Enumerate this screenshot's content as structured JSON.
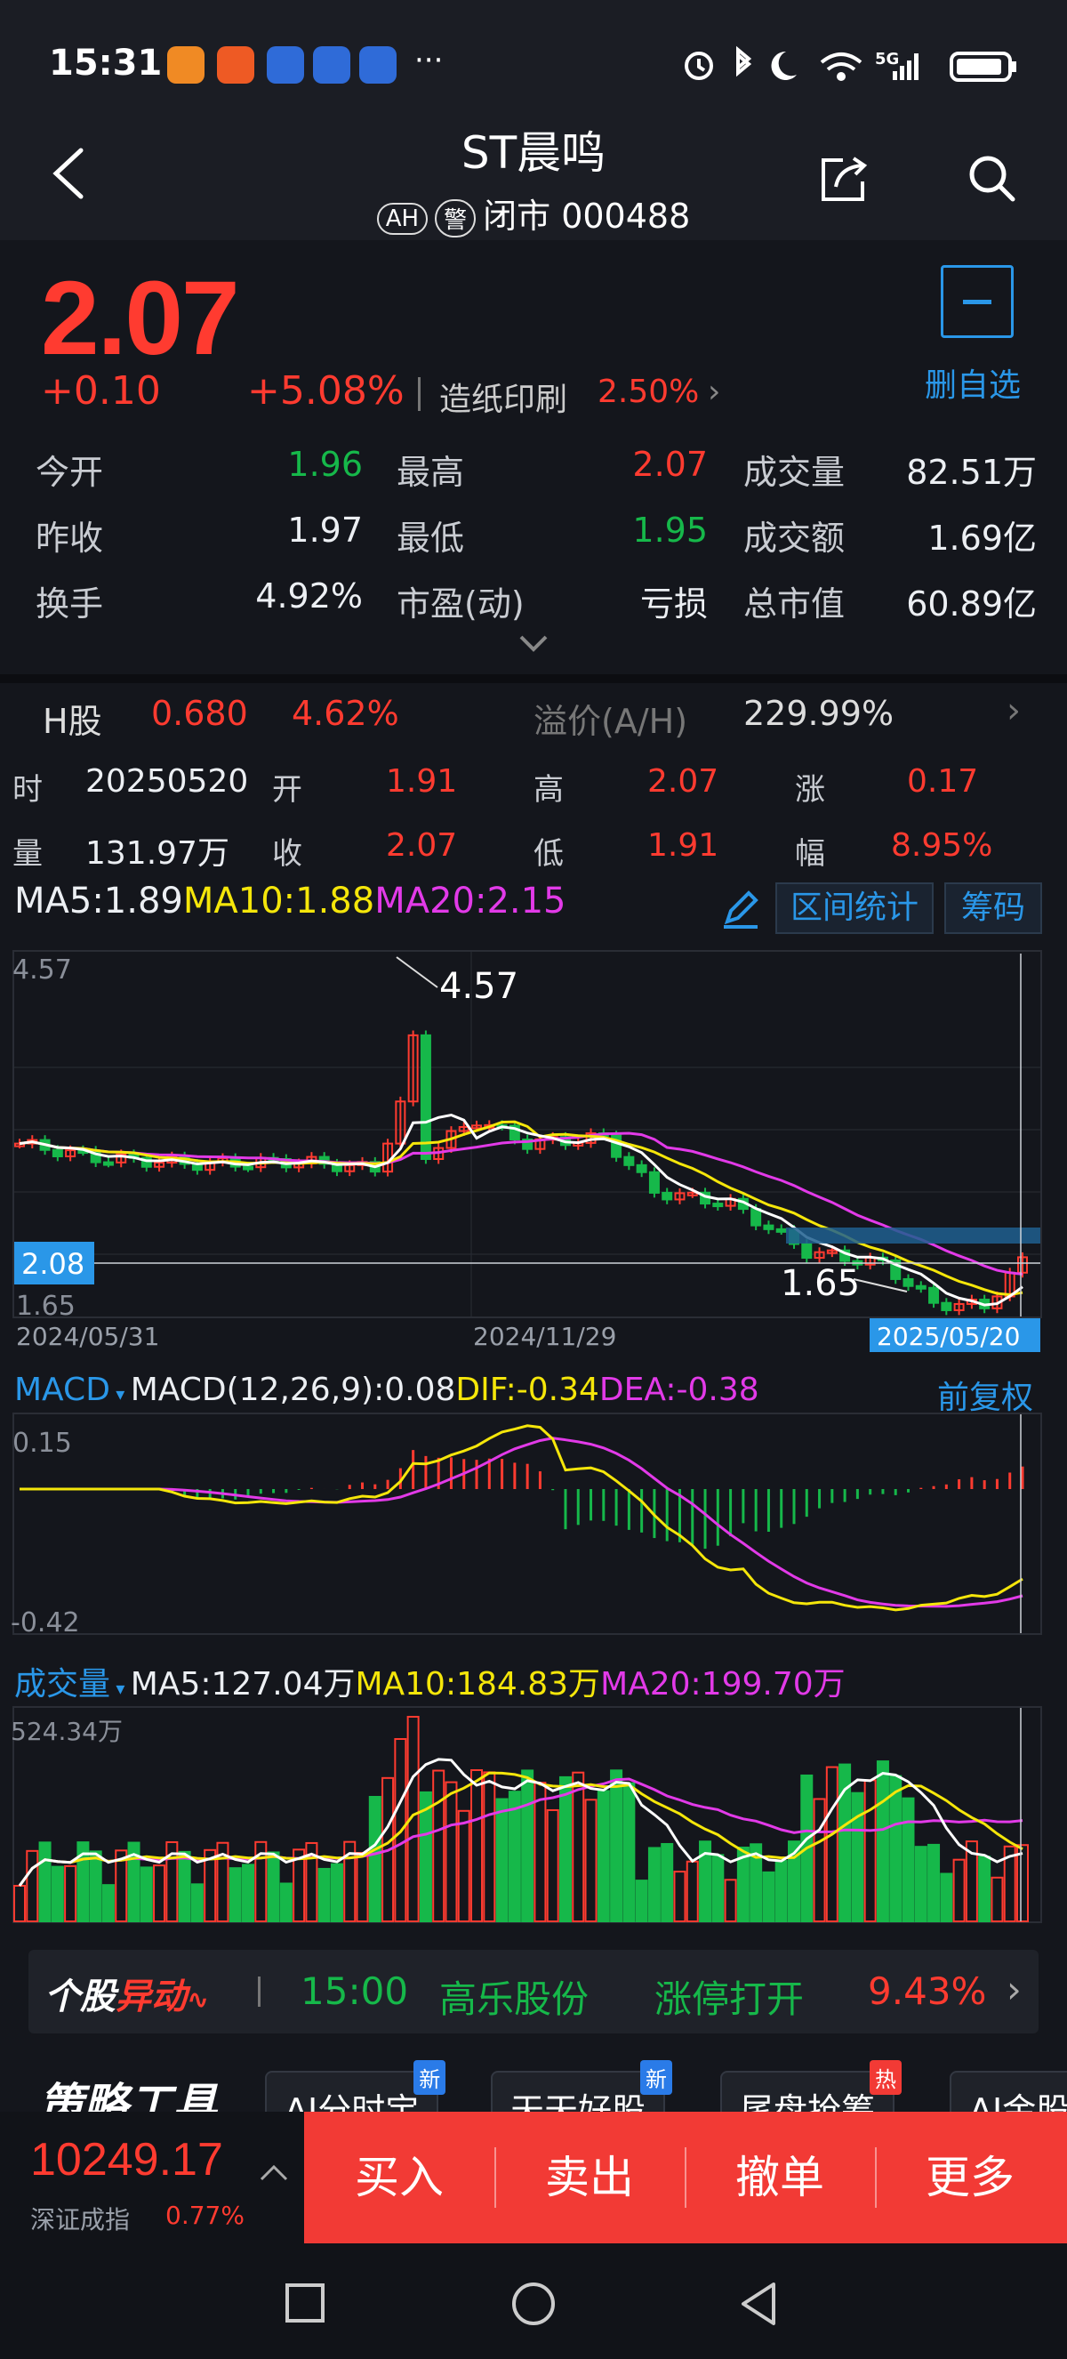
{
  "status_bar": {
    "time": "15:31",
    "dots": "···",
    "network": "5G"
  },
  "header": {
    "title": "ST晨鸣",
    "badge_ah": "AH",
    "badge_warn": "警",
    "subtitle": "闭市 000488"
  },
  "quote": {
    "price": "2.07",
    "change": "+0.10",
    "change_pct": "+5.08%",
    "sector": "造纸印刷",
    "sector_pct": "2.50%",
    "watch_label": "删自选",
    "open_label": "今开",
    "open": "1.96",
    "high_label": "最高",
    "high": "2.07",
    "volume_label": "成交量",
    "volume": "82.51万",
    "prev_close_label": "昨收",
    "prev_close": "1.97",
    "low_label": "最低",
    "low": "1.95",
    "amount_label": "成交额",
    "amount": "1.69亿",
    "turnover_label": "换手",
    "turnover": "4.92%",
    "pe_label": "市盈(动)",
    "pe": "亏损",
    "mktcap_label": "总市值",
    "mktcap": "60.89亿"
  },
  "h_share": {
    "label": "H股",
    "price": "0.680",
    "pct": "4.62%",
    "premium_label": "溢价(A/H)",
    "premium": "229.99%"
  },
  "day_info": {
    "date_label": "时",
    "date": "20250520",
    "open_label": "开",
    "open": "1.91",
    "high_label": "高",
    "high": "2.07",
    "rise_label": "涨",
    "rise": "0.17",
    "vol_label": "量",
    "vol": "131.97万",
    "close_label": "收",
    "close": "2.07",
    "low_label": "低",
    "low": "1.91",
    "amp_label": "幅",
    "amp": "8.95%"
  },
  "ma": {
    "ma5": "MA5:1.89",
    "ma10": "MA10:1.88",
    "ma20": "MA20:2.15",
    "interval_label": "区间统计",
    "chips_label": "筹码"
  },
  "kline": {
    "y_max_label": "4.57",
    "y_min_label": "1.65",
    "peak_label": "4.57",
    "trough_label": "1.65",
    "cursor_label": "2.08",
    "date_start": "2024/05/31",
    "date_mid": "2024/11/29",
    "date_end": "2025/05/20"
  },
  "macd": {
    "title": "MACD",
    "params": "MACD(12,26,9):0.08",
    "dif": "DIF:-0.34",
    "dea": "DEA:-0.38",
    "adjust_label": "前复权",
    "y_max_label": "0.15",
    "y_min_label": "-0.42"
  },
  "volume": {
    "title": "成交量",
    "ma5": "MA5:127.04万",
    "ma10": "MA10:184.83万",
    "ma20": "MA20:199.70万",
    "y_max_label": "524.34万"
  },
  "news": {
    "tag1": "个股",
    "tag2": "异动",
    "time": "15:00",
    "stock": "高乐股份",
    "event": "涨停打开",
    "pct": "9.43%"
  },
  "tools": {
    "title": "策略工具",
    "items": [
      {
        "label": "AI分时宝",
        "badge": "新"
      },
      {
        "label": "天天好股",
        "badge": "新"
      },
      {
        "label": "尾盘抢筹",
        "badge": "热"
      },
      {
        "label": "AI金股",
        "badge": ""
      }
    ]
  },
  "index": {
    "value": "10249.17",
    "name": "深证成指",
    "pct": "0.77%"
  },
  "actions": {
    "buy": "买入",
    "sell": "卖出",
    "cancel": "撤单",
    "more": "更多"
  },
  "colors": {
    "up": "#ff3b30",
    "down": "#16b84a",
    "accent": "#2a97e8",
    "ma5": "#ffffff",
    "ma10": "#f5e60a",
    "ma20": "#e23ae8"
  }
}
